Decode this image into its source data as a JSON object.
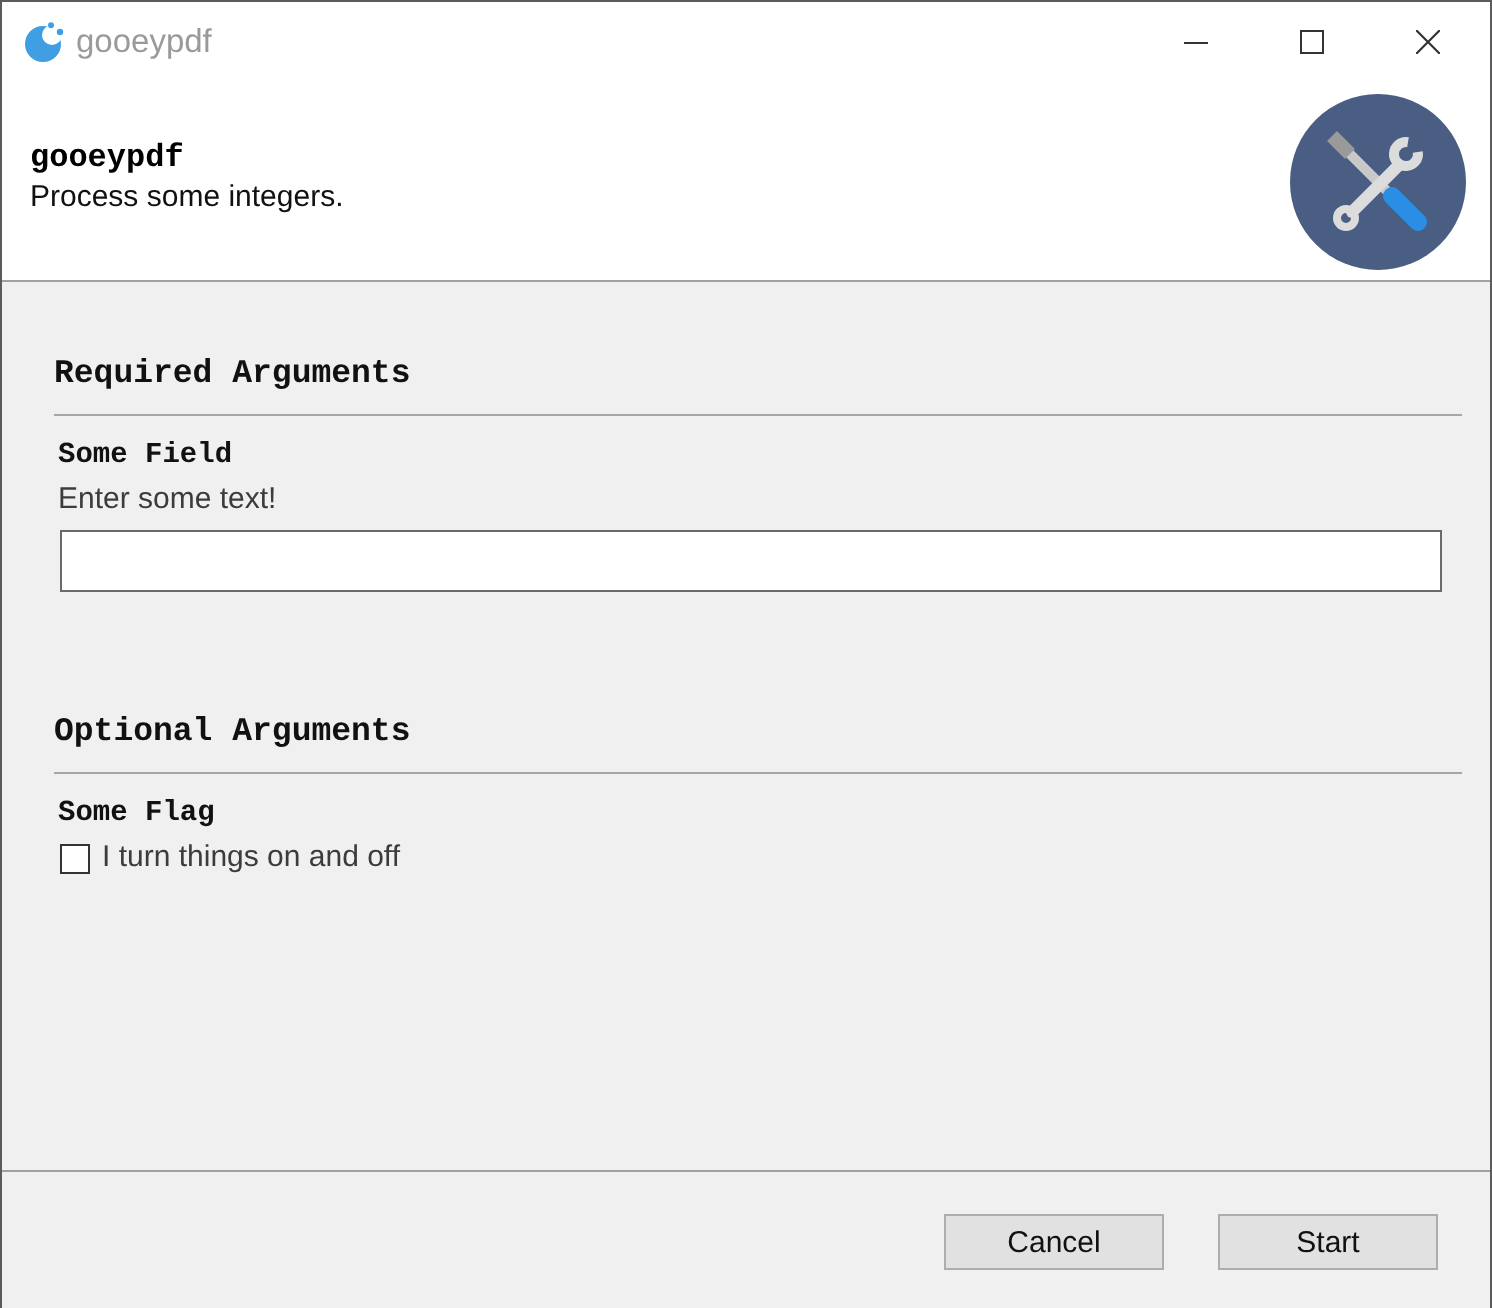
{
  "window": {
    "title": "gooeypdf"
  },
  "header": {
    "title": "gooeypdf",
    "subtitle": "Process some integers."
  },
  "sections": [
    {
      "title": "Required Arguments",
      "fields": [
        {
          "kind": "text",
          "label": "Some Field",
          "help": "Enter some text!"
        }
      ]
    },
    {
      "title": "Optional Arguments",
      "fields": [
        {
          "kind": "checkbox",
          "label": "Some Flag",
          "text": "I turn things on and off",
          "checked": false
        }
      ]
    }
  ],
  "buttons": [
    {
      "label": "Cancel"
    },
    {
      "label": "Start"
    }
  ]
}
